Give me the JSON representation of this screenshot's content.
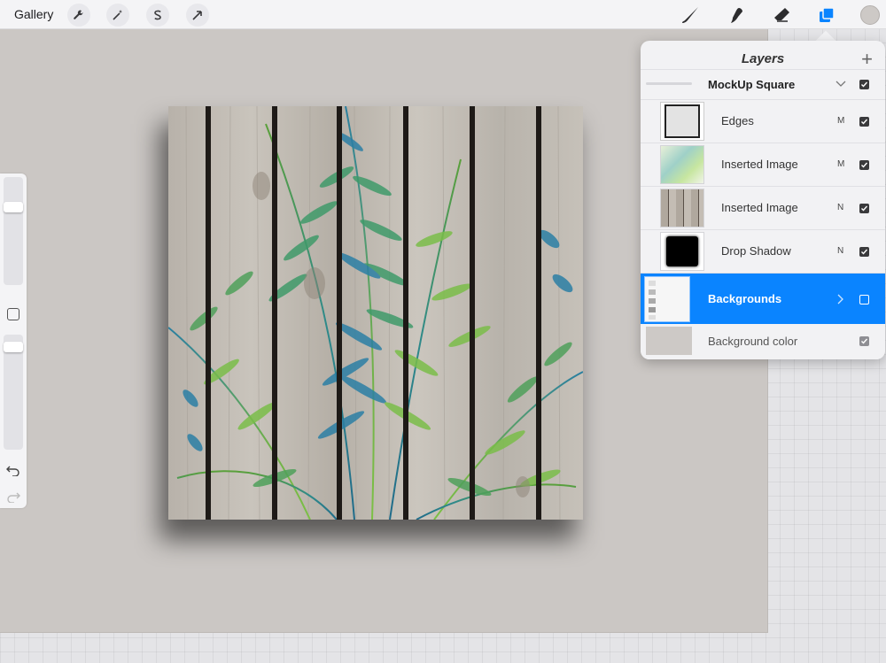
{
  "toolbar": {
    "gallery_label": "Gallery",
    "actions_icon": "wrench-icon",
    "adjustments_icon": "magic-wand-icon",
    "selection_icon": "selection-s-icon",
    "transform_icon": "arrow-cursor-icon",
    "brush_icon": "brush-icon",
    "smudge_icon": "smudge-icon",
    "eraser_icon": "eraser-icon",
    "layers_icon": "layers-icon",
    "accent_color": "#0a84ff",
    "current_color": "#cdc9c6"
  },
  "layers_panel": {
    "title": "Layers",
    "add_label": "+",
    "group": {
      "name": "MockUp Square"
    },
    "layers": [
      {
        "name": "Edges",
        "blend": "M",
        "visible": true
      },
      {
        "name": "Inserted Image",
        "blend": "M",
        "visible": true
      },
      {
        "name": "Inserted Image",
        "blend": "N",
        "visible": true
      },
      {
        "name": "Drop Shadow",
        "blend": "N",
        "visible": true
      }
    ],
    "selected_group": {
      "name": "Backgrounds",
      "visible": false
    },
    "background": {
      "name": "Background color",
      "visible": true
    }
  }
}
